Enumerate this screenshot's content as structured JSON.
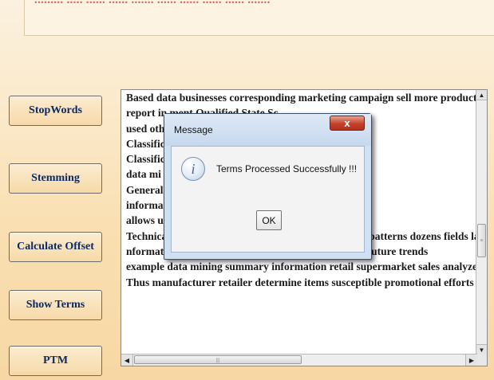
{
  "header": {
    "ghost_text": "......... ..... ...... ...... ....... ...... ...... ...... ...... ......."
  },
  "buttons": {
    "stopwords": "StopWords",
    "stemming": "Stemming",
    "calculate_offset": "Calculate Offset",
    "show_terms": "Show Terms",
    "ptm": "PTM"
  },
  "textarea": {
    "lines": [
      "Based data businesses corresponding marketing campaign sell more product",
      "report in                                         ment Qualified State Sc",
      "used oth",
      "Classific                                          ine learning Basically c",
      "Classific                                          es such decision trees li",
      "data mi                                            que also defines classes",
      "General                                             dge discovery process ar",
      "informa                                             ta mining software nur",
      "allows u                                            angles categorize  sum",
      "Technically data mining process finding correlations patterns dozens fields la",
      "nformation converted knowledge historical patterns future trends",
      "example data mining summary information retail supermarket sales analyze",
      "Thus manufacturer retailer determine items susceptible promotional efforts"
    ]
  },
  "dialog": {
    "title": "Message",
    "close_label": "x",
    "message": "Terms Processed Successfully !!!",
    "ok_label": "OK",
    "icon": "info-icon"
  },
  "colors": {
    "button_text": "#0b2a63",
    "dialog_close": "#c4412c",
    "background": "#f9dfb2"
  }
}
